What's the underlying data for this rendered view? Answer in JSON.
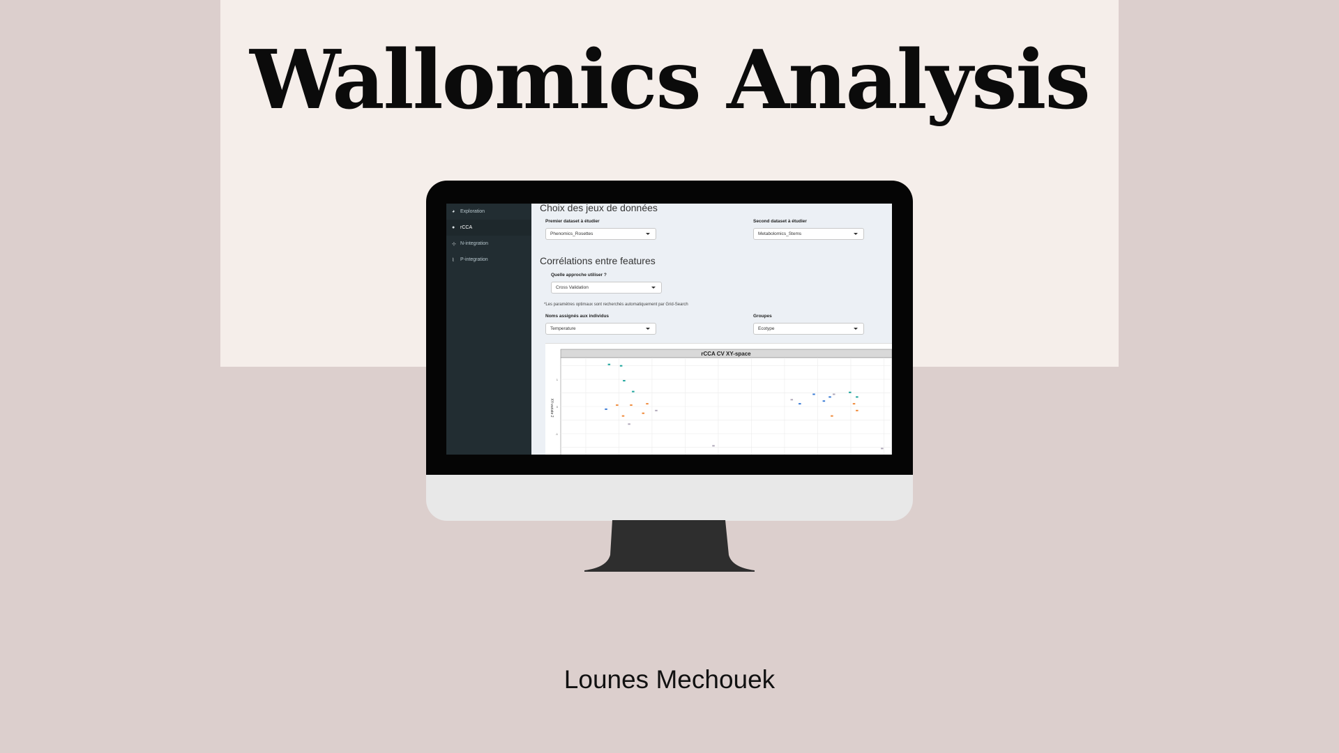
{
  "slide": {
    "title": "Wallomics Analysis",
    "author": "Lounes Mechouek"
  },
  "sidebar": {
    "items": [
      {
        "label": "Exploration",
        "icon": "pie-chart-icon",
        "active": false
      },
      {
        "label": "rCCA",
        "icon": "circles-icon",
        "active": true
      },
      {
        "label": "N-integration",
        "icon": "network-icon",
        "active": false
      },
      {
        "label": "P-integration",
        "icon": "line-chart-icon",
        "active": false
      }
    ]
  },
  "main": {
    "section1_title": "Choix des jeux de données",
    "dataset1": {
      "label": "Premier dataset à étudier",
      "value": "Phenomics_Rosettes"
    },
    "dataset2": {
      "label": "Second dataset à étudier",
      "value": "Metabolomics_Stems"
    },
    "section2_title": "Corrélations entre features",
    "approach": {
      "label": "Quelle approche utiliser ?",
      "value": "Cross Validation"
    },
    "note": "*Les paramètres optimaux sont recherchés automatiquement par Grid-Search",
    "names": {
      "label": "Noms assignés aux individus",
      "value": "Temperature"
    },
    "groups": {
      "label": "Groupes",
      "value": "Ecotype"
    }
  },
  "chart_data": {
    "type": "scatter",
    "title": "rCCA CV XY-space",
    "ylabel": "XY-variate 2",
    "xlabel": "",
    "ytick_labels": [
      "1",
      "0",
      "-1"
    ],
    "grid": true,
    "series": [
      {
        "color": "#1aa39a",
        "x": [
          0.48,
          0.6,
          0.63,
          0.72,
          2.88,
          2.95
        ],
        "y": [
          1.55,
          1.5,
          0.95,
          0.55,
          0.52,
          0.35
        ]
      },
      {
        "color": "#f08a3a",
        "x": [
          0.56,
          0.62,
          0.7,
          0.82,
          0.86,
          2.7,
          2.92,
          2.95
        ],
        "y": [
          0.05,
          -0.35,
          0.05,
          -0.25,
          0.1,
          -0.35,
          0.1,
          -0.15
        ]
      },
      {
        "color": "#3a7bd5",
        "x": [
          0.45,
          2.38,
          2.52,
          2.62,
          2.68
        ],
        "y": [
          -0.1,
          0.1,
          0.45,
          0.2,
          0.35
        ]
      },
      {
        "color": "#b0a8b9",
        "x": [
          0.68,
          0.95,
          1.52,
          2.3,
          2.72,
          3.2
        ],
        "y": [
          -0.65,
          -0.15,
          -1.45,
          0.25,
          0.45,
          -1.55
        ]
      }
    ]
  },
  "colors": {
    "background": "#dccfcd",
    "panel": "#f5eeea",
    "sidebar": "#222d32",
    "content": "#ecf0f5"
  }
}
